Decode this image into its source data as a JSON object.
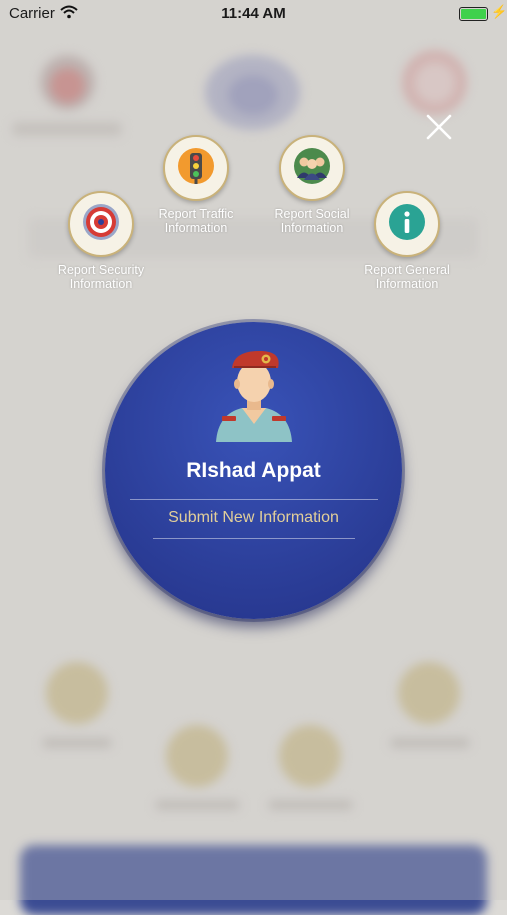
{
  "status_bar": {
    "carrier": "Carrier",
    "time": "11:44 AM"
  },
  "report_options": [
    {
      "id": "security",
      "label": "Report Security Information",
      "icon": "target-icon"
    },
    {
      "id": "traffic",
      "label": "Report Traffic Information",
      "icon": "traffic-light-icon"
    },
    {
      "id": "social",
      "label": "Report Social Information",
      "icon": "people-group-icon"
    },
    {
      "id": "general",
      "label": "Report General Information",
      "icon": "info-icon"
    }
  ],
  "profile": {
    "name": "RIshad Appat",
    "submit_label": "Submit New Information"
  },
  "colors": {
    "primary_blue": "#2c3f9a",
    "gold_text": "#e2cf9a",
    "battery_green": "#3fd14c"
  }
}
